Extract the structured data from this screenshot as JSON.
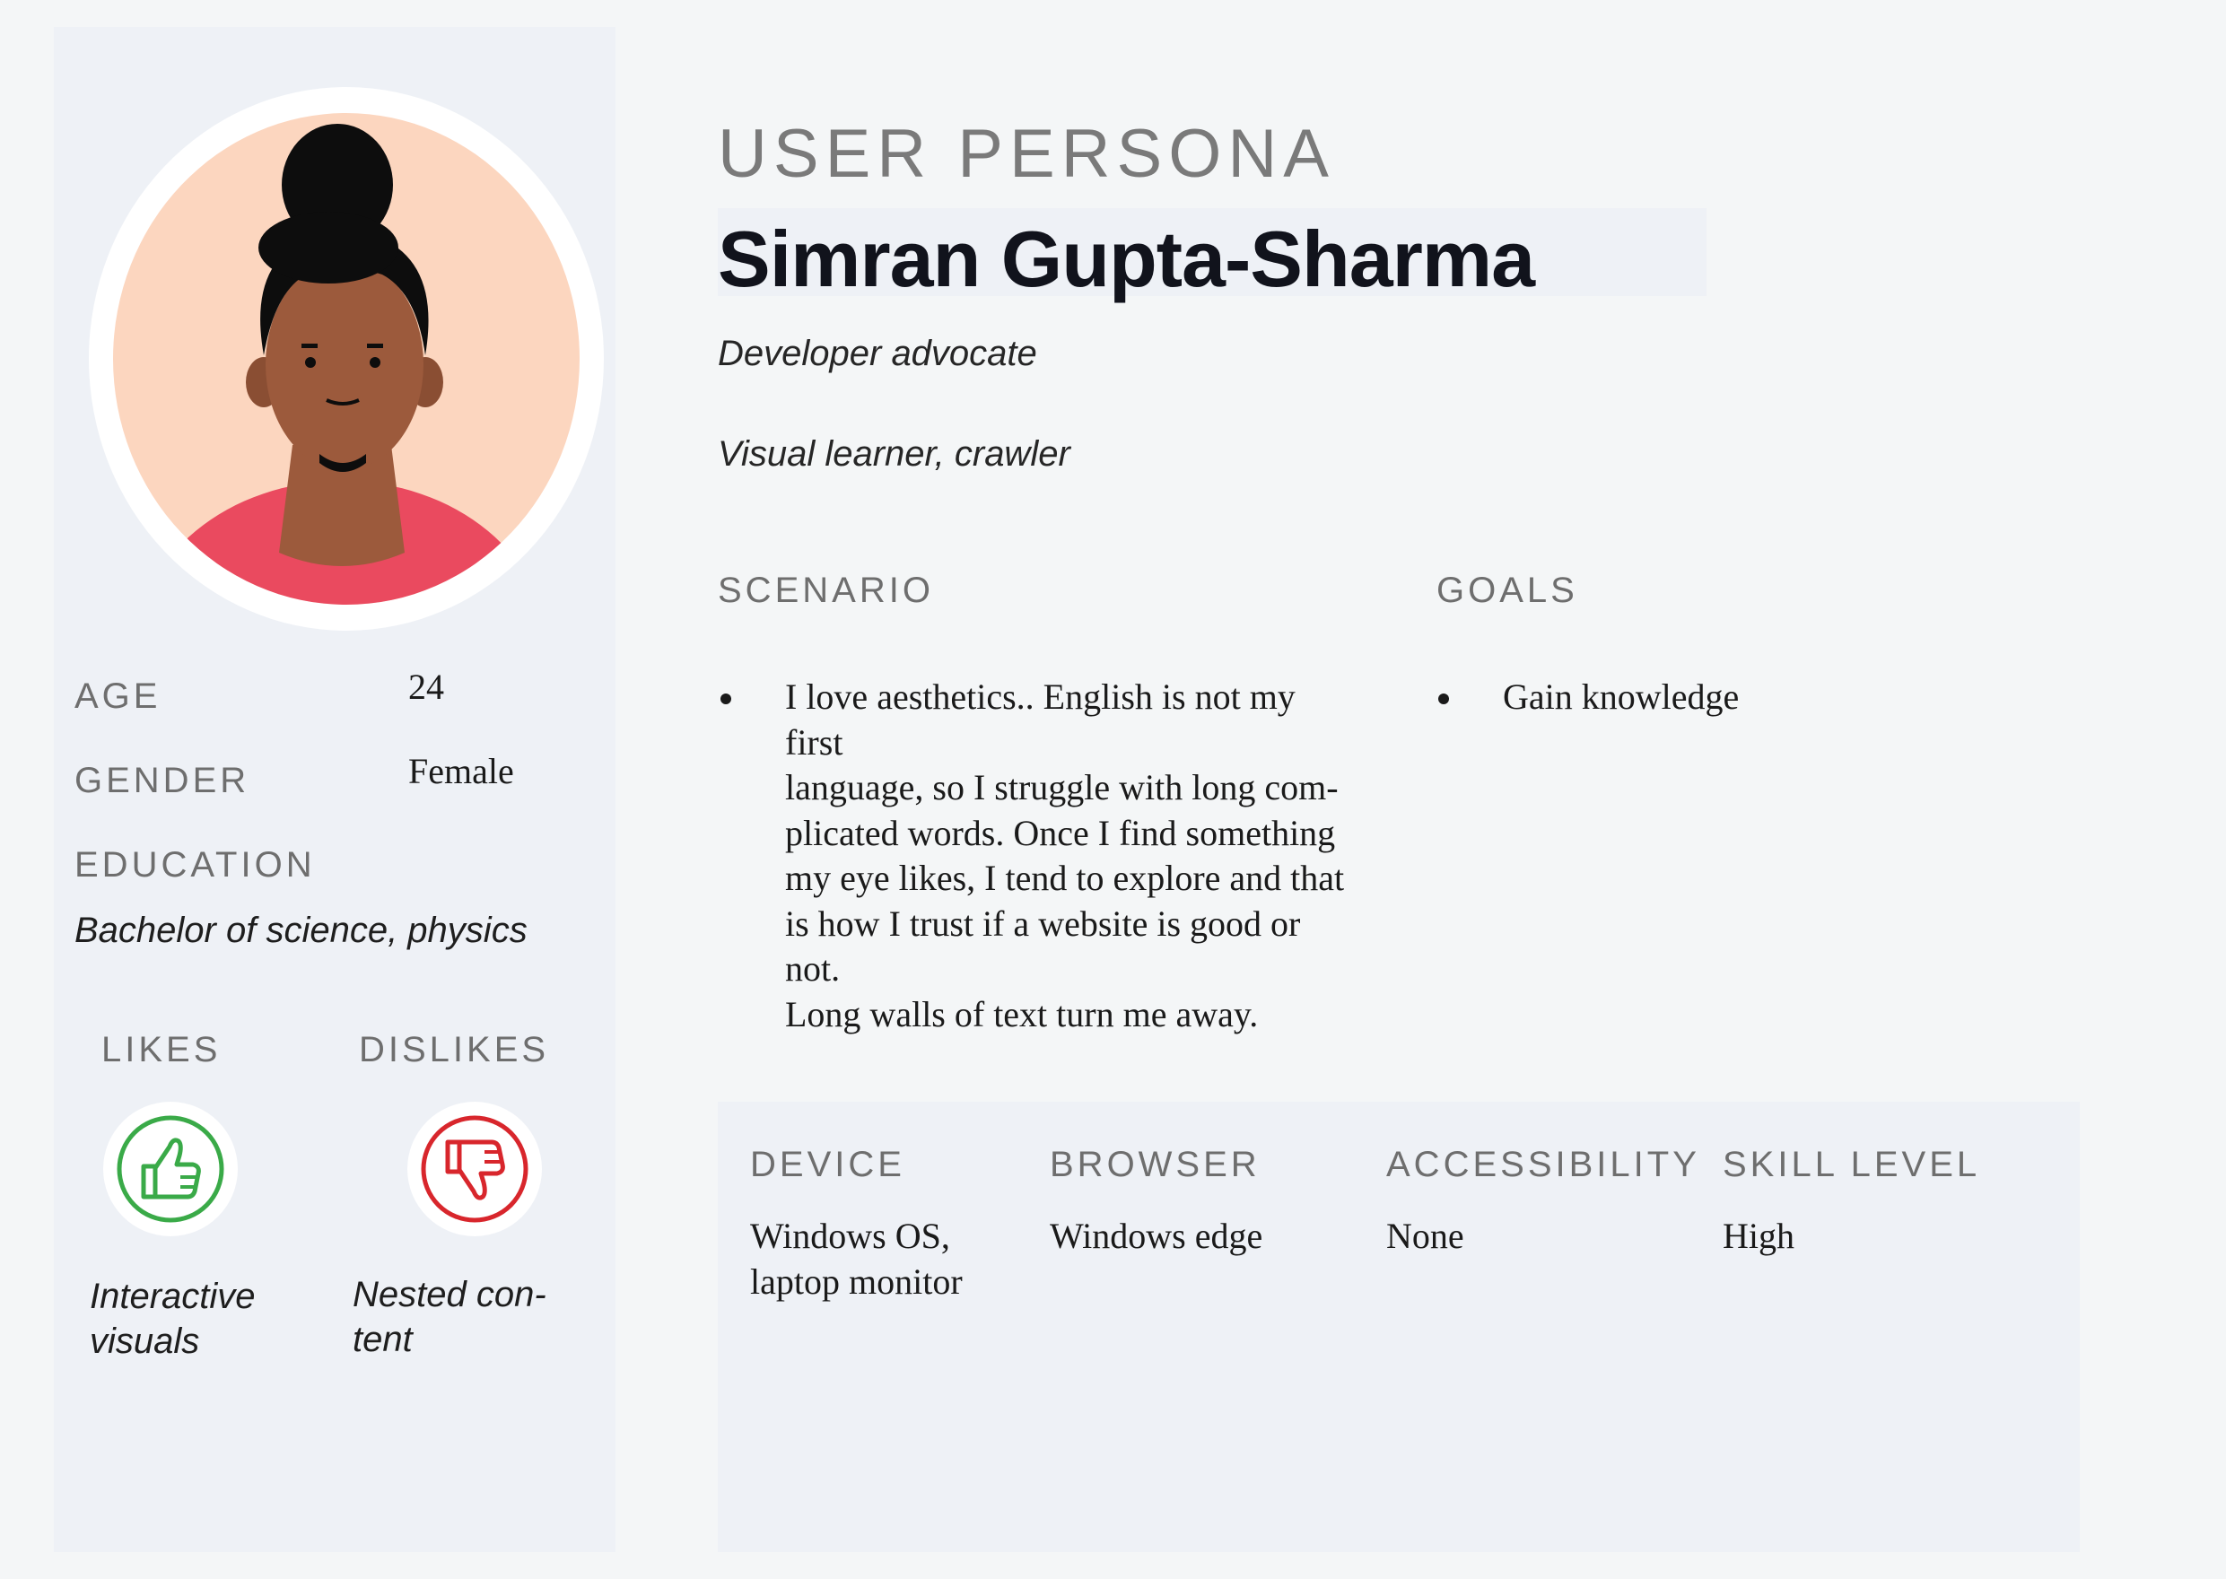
{
  "header": {
    "eyebrow": "USER PERSONA",
    "name": "Simran Gupta-Sharma",
    "role": "Developer advocate",
    "tagline": "Visual learner, crawler"
  },
  "profile": {
    "age_label": "AGE",
    "age_value": "24",
    "gender_label": "GENDER",
    "gender_value": "Female",
    "education_label": "EDUCATION",
    "education_value": "Bachelor of science, physics"
  },
  "preferences": {
    "likes_label": "LIKES",
    "likes_line1": "Interactive",
    "likes_line2": "visuals",
    "dislikes_label": "DISLIKES",
    "dislikes_line1": "Nested con-",
    "dislikes_line2": "tent"
  },
  "scenario": {
    "label": "SCENARIO",
    "lines": [
      "I love aesthetics.. English is not my first",
      "language, so I struggle with long com-",
      "plicated words. Once I find something",
      "my eye likes, I tend to explore and that",
      "is how I trust if a website is good or not.",
      "Long walls of text turn me away."
    ]
  },
  "goals": {
    "label": "GOALS",
    "items": [
      "Gain knowledge"
    ]
  },
  "tech": {
    "device_label": "DEVICE",
    "device_line1": "Windows OS,",
    "device_line2": "laptop monitor",
    "browser_label": "BROWSER",
    "browser_value": "Windows edge",
    "accessibility_label": "ACCESSIBILITY",
    "accessibility_value": "None",
    "skill_label": "SKILL LEVEL",
    "skill_value": "High"
  },
  "colors": {
    "background": "#f4f6f7",
    "panel": "#eef1f6",
    "like_green": "#3aaa48",
    "dislike_red": "#d8262c",
    "avatar_skin_bg": "#fcd6bf",
    "shirt": "#ea4a5f"
  },
  "icons": {
    "likes": "thumbs-up-icon",
    "dislikes": "thumbs-down-icon"
  }
}
